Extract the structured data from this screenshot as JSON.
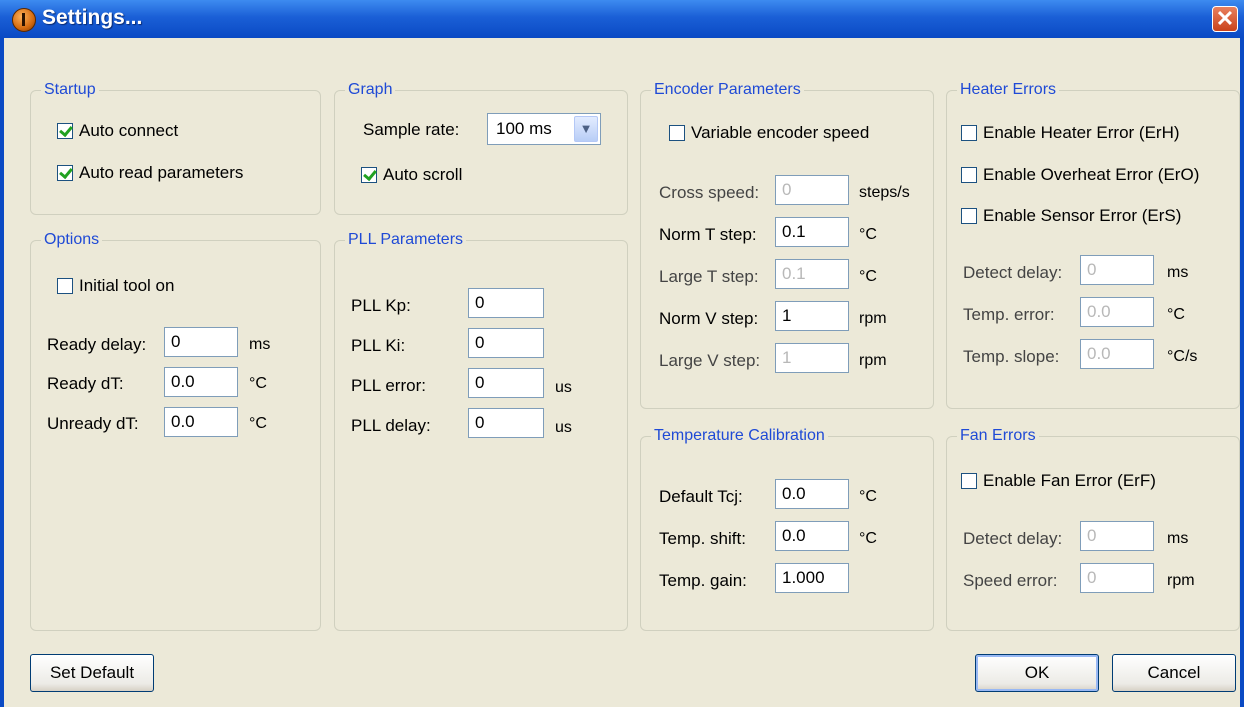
{
  "window": {
    "title": "Settings...",
    "close_glyph": "✕"
  },
  "startup": {
    "legend": "Startup",
    "auto_connect": {
      "label": "Auto connect",
      "checked": true
    },
    "auto_read": {
      "label": "Auto read parameters",
      "checked": true
    }
  },
  "graph": {
    "legend": "Graph",
    "sample_rate_label": "Sample rate:",
    "sample_rate_value": "100 ms",
    "auto_scroll": {
      "label": "Auto scroll",
      "checked": true
    }
  },
  "encoder": {
    "legend": "Encoder Parameters",
    "variable_speed": {
      "label": "Variable encoder speed",
      "checked": false
    },
    "cross_speed": {
      "label": "Cross speed:",
      "value": "0",
      "unit": "steps/s"
    },
    "norm_t_step": {
      "label": "Norm T step:",
      "value": "0.1",
      "unit": "°C"
    },
    "large_t_step": {
      "label": "Large T step:",
      "value": "0.1",
      "unit": "°C"
    },
    "norm_v_step": {
      "label": "Norm V step:",
      "value": "1",
      "unit": "rpm"
    },
    "large_v_step": {
      "label": "Large V step:",
      "value": "1",
      "unit": "rpm"
    }
  },
  "heater": {
    "legend": "Heater Errors",
    "enable_heater": {
      "label": "Enable Heater Error (ErH)",
      "checked": false
    },
    "enable_overheat": {
      "label": "Enable Overheat Error (ErO)",
      "checked": false
    },
    "enable_sensor": {
      "label": "Enable Sensor Error (ErS)",
      "checked": false
    },
    "detect_delay": {
      "label": "Detect delay:",
      "value": "0",
      "unit": "ms"
    },
    "temp_error": {
      "label": "Temp. error:",
      "value": "0.0",
      "unit": "°C"
    },
    "temp_slope": {
      "label": "Temp. slope:",
      "value": "0.0",
      "unit": "°C/s"
    }
  },
  "options": {
    "legend": "Options",
    "initial_tool": {
      "label": "Initial tool on",
      "checked": false
    },
    "ready_delay": {
      "label": "Ready delay:",
      "value": "0",
      "unit": "ms"
    },
    "ready_dt": {
      "label": "Ready dT:",
      "value": "0.0",
      "unit": "°C"
    },
    "unready_dt": {
      "label": "Unready dT:",
      "value": "0.0",
      "unit": "°C"
    }
  },
  "pll": {
    "legend": "PLL Parameters",
    "kp": {
      "label": "PLL Kp:",
      "value": "0",
      "unit": ""
    },
    "ki": {
      "label": "PLL Ki:",
      "value": "0",
      "unit": ""
    },
    "error": {
      "label": "PLL error:",
      "value": "0",
      "unit": "us"
    },
    "delay": {
      "label": "PLL delay:",
      "value": "0",
      "unit": "us"
    }
  },
  "temp_cal": {
    "legend": "Temperature Calibration",
    "default_tcj": {
      "label": "Default Tcj:",
      "value": "0.0",
      "unit": "°C"
    },
    "temp_shift": {
      "label": "Temp. shift:",
      "value": "0.0",
      "unit": "°C"
    },
    "temp_gain": {
      "label": "Temp. gain:",
      "value": "1.000"
    }
  },
  "fan": {
    "legend": "Fan Errors",
    "enable_fan": {
      "label": "Enable Fan Error (ErF)",
      "checked": false
    },
    "detect_delay": {
      "label": "Detect delay:",
      "value": "0",
      "unit": "ms"
    },
    "speed_error": {
      "label": "Speed error:",
      "value": "0",
      "unit": "rpm"
    }
  },
  "buttons": {
    "set_default": "Set Default",
    "ok": "OK",
    "cancel": "Cancel"
  }
}
